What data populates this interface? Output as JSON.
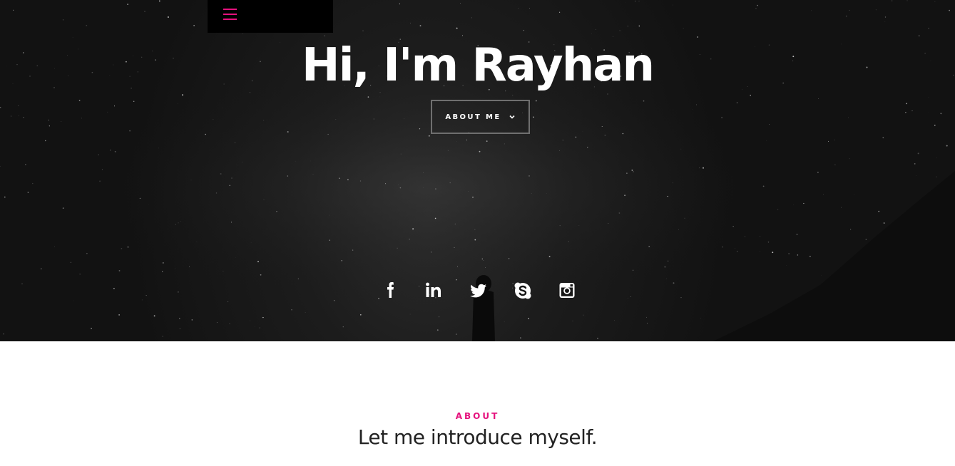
{
  "hero": {
    "title": "Hi, I'm Rayhan",
    "about_button": {
      "label": "ABOUT ME",
      "icon": "chevron-down-icon"
    },
    "menu_icon": "hamburger-menu-icon",
    "social_links": [
      {
        "name": "facebook",
        "icon": "facebook-icon"
      },
      {
        "name": "linkedin",
        "icon": "linkedin-icon"
      },
      {
        "name": "twitter",
        "icon": "twitter-icon"
      },
      {
        "name": "skype",
        "icon": "skype-icon"
      },
      {
        "name": "instagram",
        "icon": "instagram-icon"
      }
    ]
  },
  "about": {
    "eyebrow": "ABOUT",
    "heading": "Let me introduce myself."
  },
  "colors": {
    "accent": "#e5127d",
    "hero_bg": "#161616",
    "heading_text": "#222222",
    "white": "#ffffff"
  }
}
